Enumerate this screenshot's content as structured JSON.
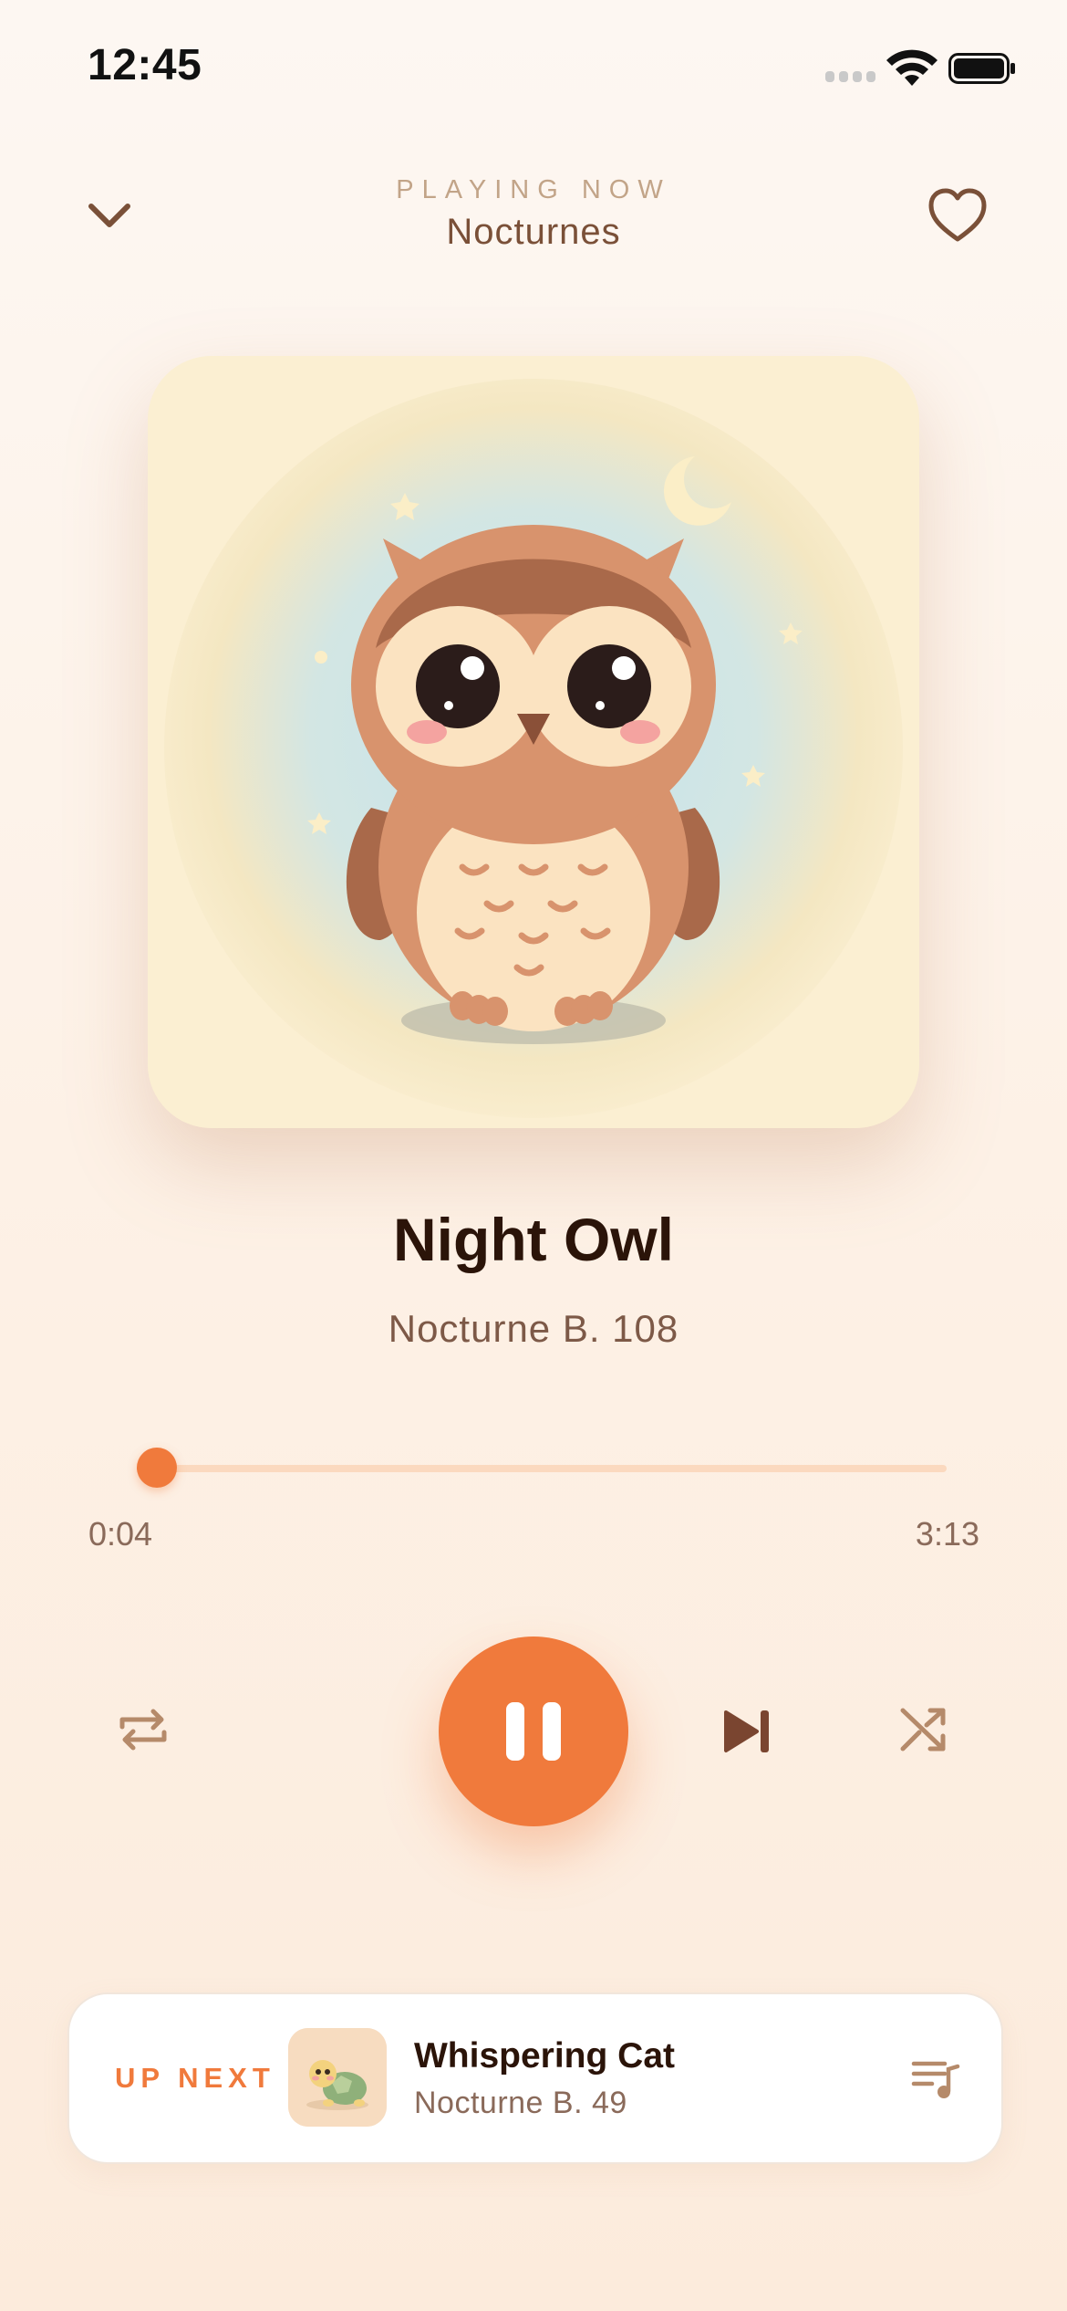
{
  "status_bar": {
    "time": "12:45"
  },
  "header": {
    "eyebrow": "PLAYING NOW",
    "playlist": "Nocturnes",
    "icons": {
      "collapse": "chevron-down-icon",
      "favorite": "heart-icon"
    }
  },
  "artwork": {
    "subject": "owl-illustration"
  },
  "track": {
    "title": "Night Owl",
    "subtitle": "Nocturne B. 108"
  },
  "progress": {
    "elapsed": "0:04",
    "total": "3:13",
    "fraction": 0.021
  },
  "controls": {
    "icons": [
      "repeat-icon",
      "pause-icon",
      "skip-next-icon",
      "shuffle-icon"
    ],
    "accent_color": "#f07a3c"
  },
  "up_next": {
    "label": "UP NEXT",
    "title": "Whispering Cat",
    "subtitle": "Nocturne B. 49",
    "icon": "queue-icon"
  }
}
